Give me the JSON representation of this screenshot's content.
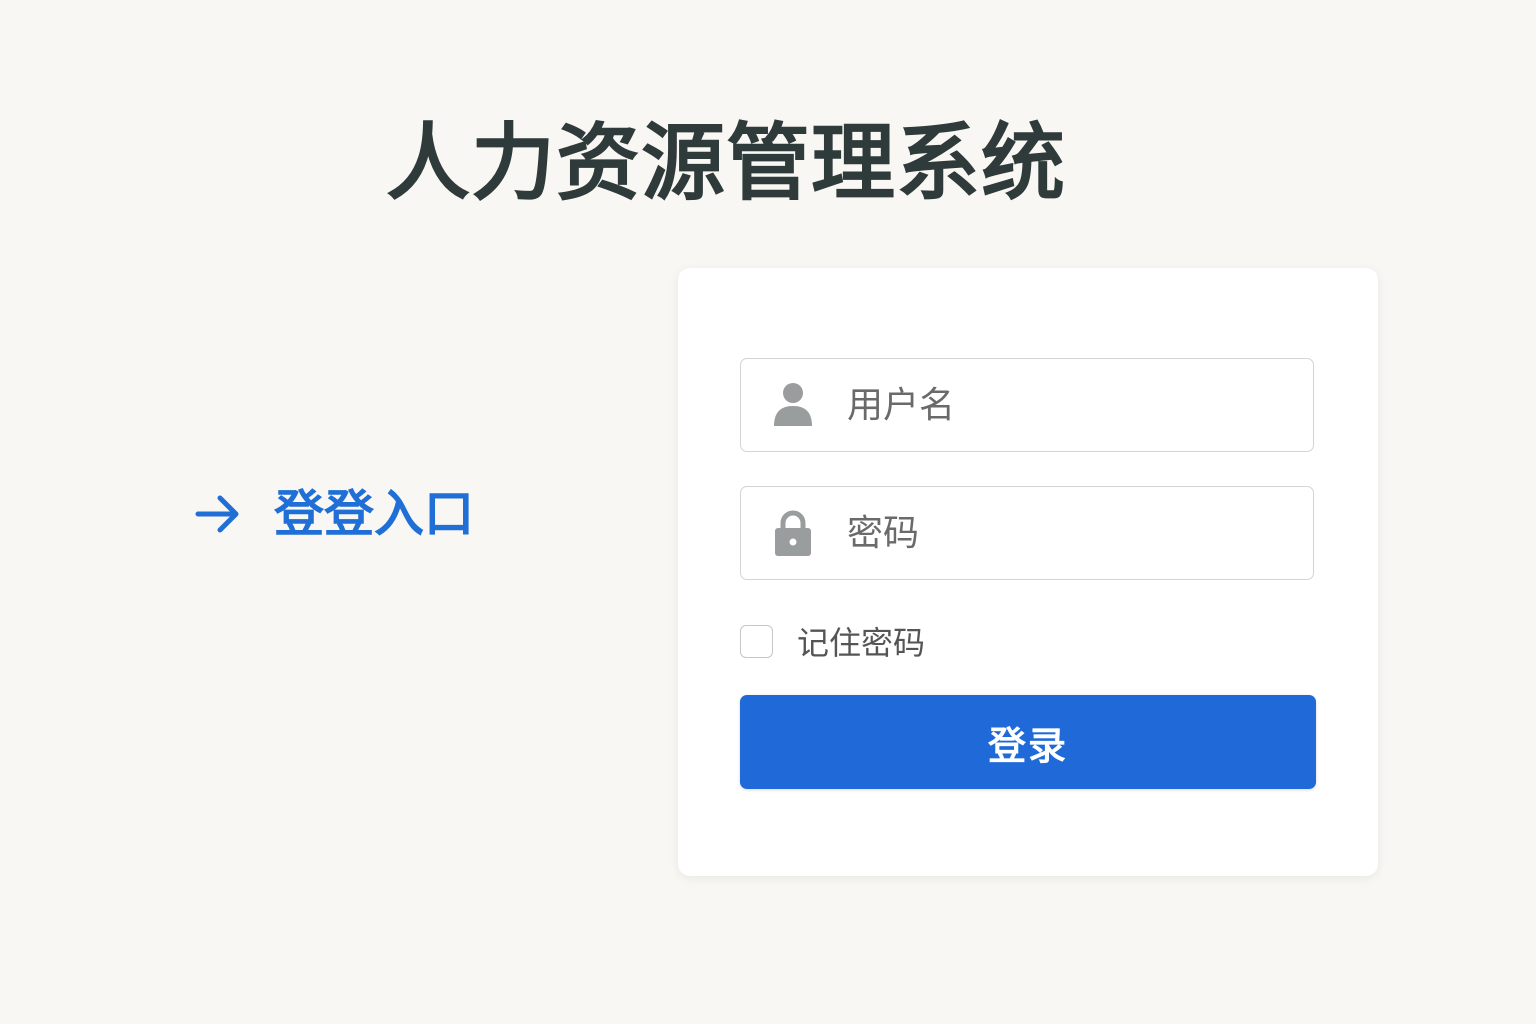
{
  "app": {
    "title": "人力资源管理系统"
  },
  "entry": {
    "label": "登登入口",
    "icon": "arrow-right-icon",
    "color": "#1f6fd6"
  },
  "login_form": {
    "username": {
      "placeholder": "用户名",
      "value": "",
      "icon": "user-icon"
    },
    "password": {
      "placeholder": "密码",
      "value": "",
      "icon": "lock-icon"
    },
    "remember": {
      "label": "记住密码",
      "checked": false
    },
    "submit_label": "登录",
    "button_color": "#1f6ad8"
  },
  "colors": {
    "background": "#f9f7f3",
    "title": "#2f3a3a",
    "icon_gray": "#9a9d9d"
  }
}
